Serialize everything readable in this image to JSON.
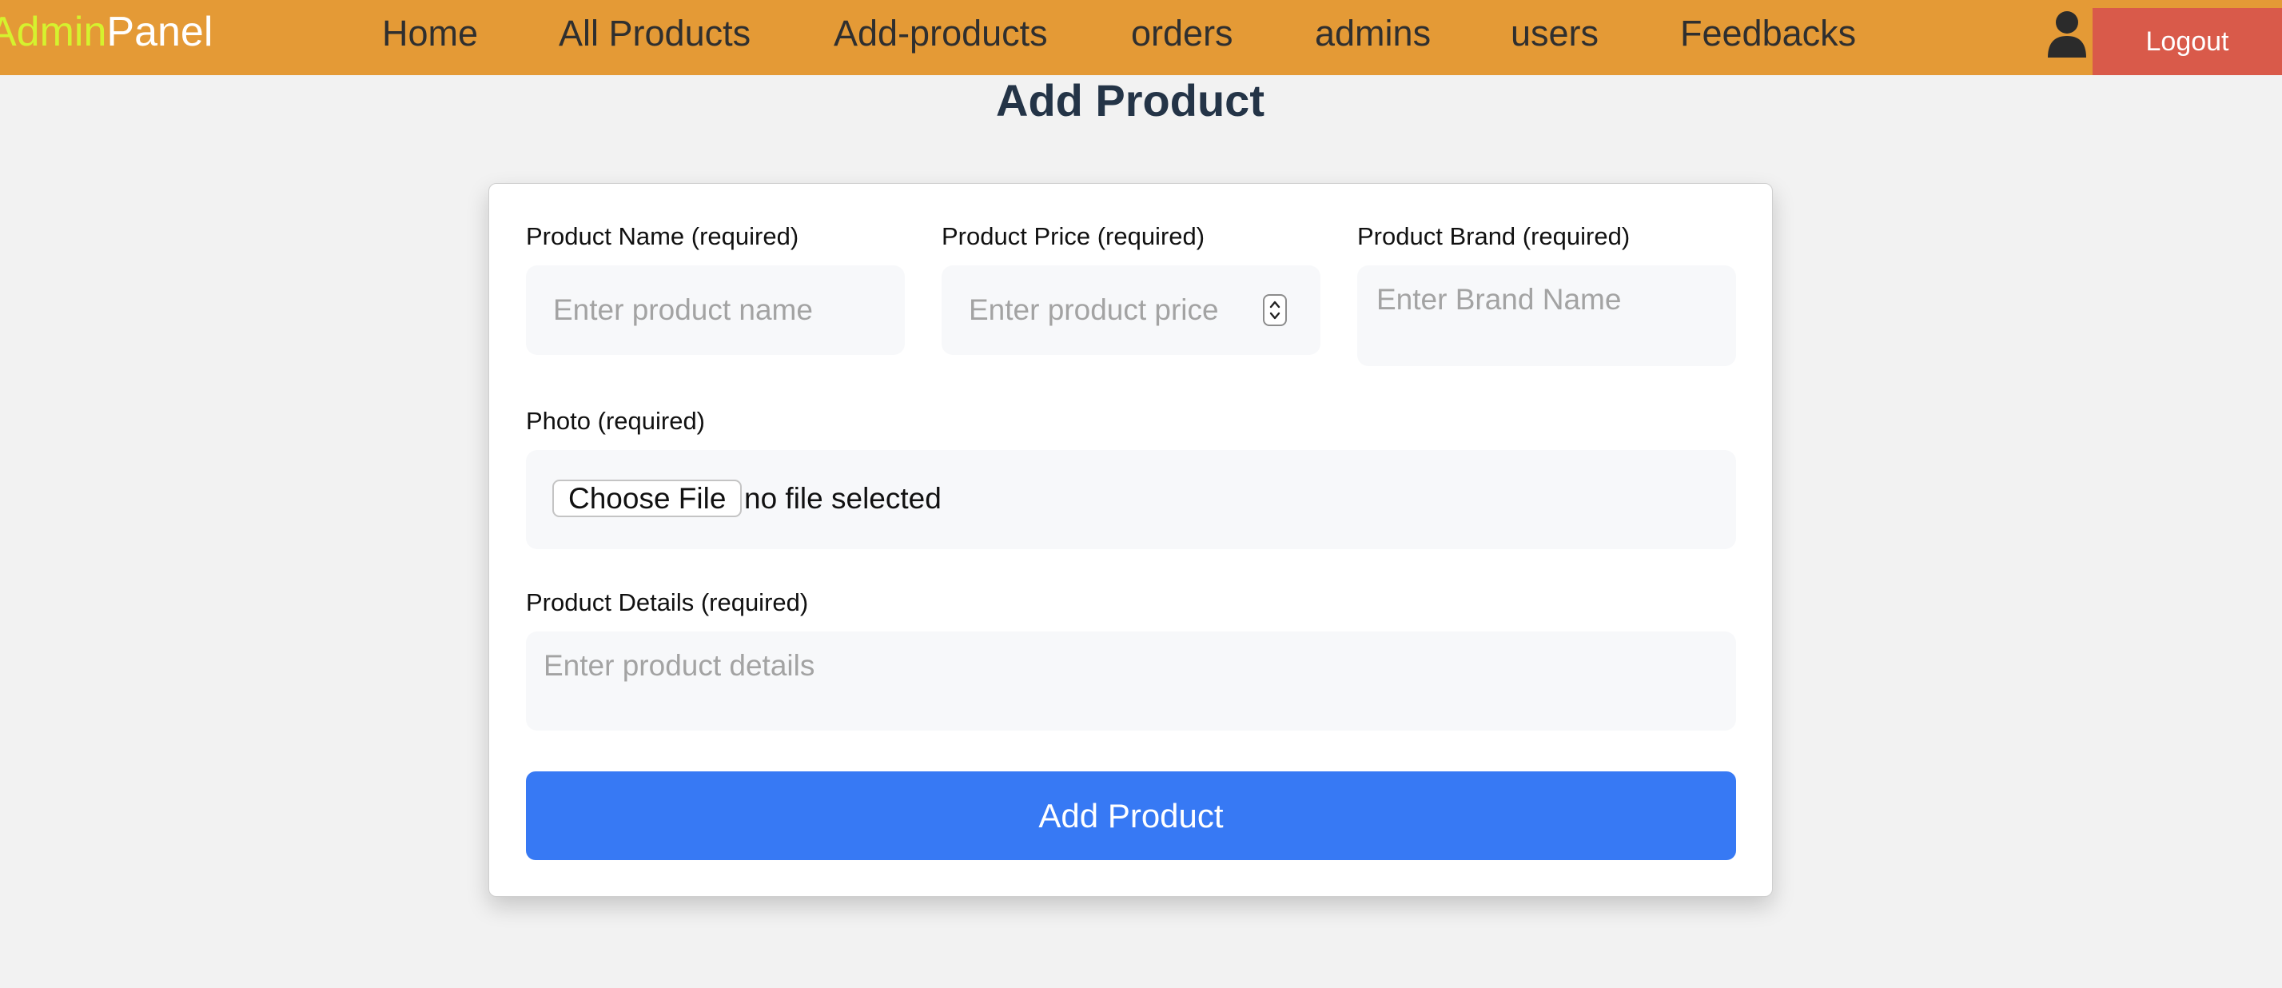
{
  "brand": {
    "part1": "Admin",
    "part2": "Panel",
    "part1_color": "#d5f22e",
    "part2_color": "#ffffff"
  },
  "nav": {
    "home": "Home",
    "all_products": "All Products",
    "add_products": "Add-products",
    "orders": "orders",
    "admins": "admins",
    "users": "users",
    "feedbacks": "Feedbacks",
    "logout": "Logout",
    "bar_color": "#e49a36",
    "logout_color": "#d95a4a"
  },
  "page": {
    "title": "Add Product"
  },
  "form": {
    "name": {
      "label": "Product Name (required)",
      "placeholder": "Enter product name",
      "value": ""
    },
    "price": {
      "label": "Product Price (required)",
      "placeholder": "Enter product price",
      "value": ""
    },
    "brand": {
      "label": "Product Brand (required)",
      "placeholder": "Enter Brand Name",
      "value": ""
    },
    "photo": {
      "label": "Photo (required)",
      "button": "Choose File",
      "status": "no file selected"
    },
    "details": {
      "label": "Product Details (required)",
      "placeholder": "Enter product details",
      "value": ""
    },
    "submit": "Add Product",
    "submit_color": "#3779f4"
  },
  "icons": {
    "user": "user-icon",
    "spinner": "number-spinner-icon"
  }
}
